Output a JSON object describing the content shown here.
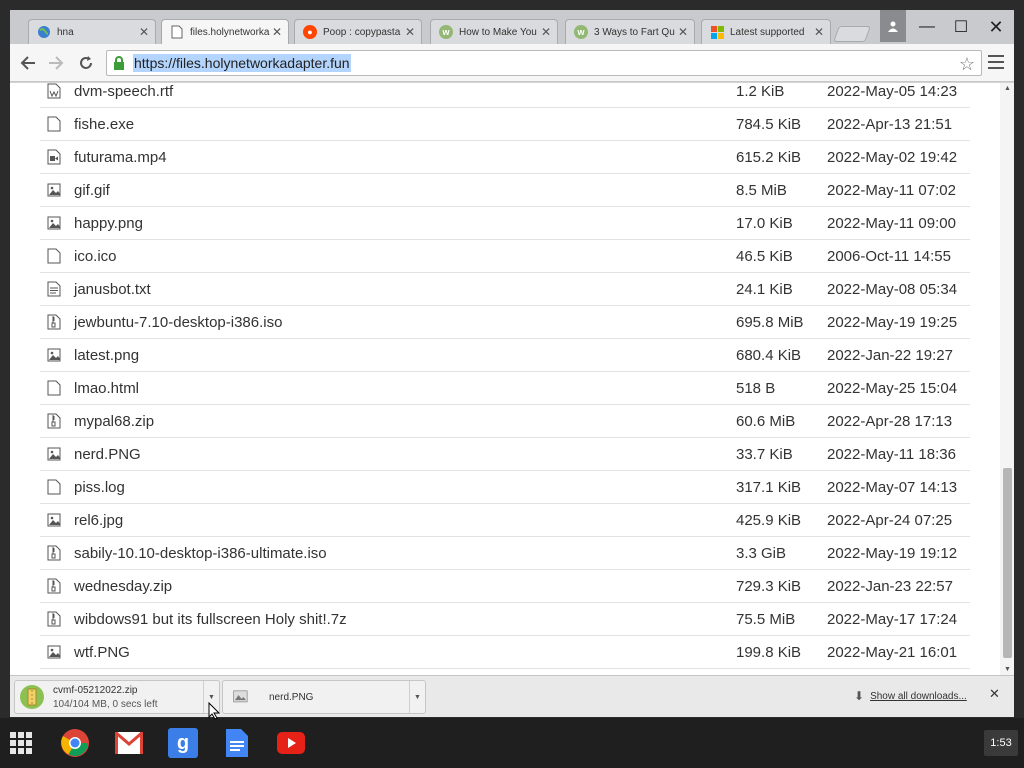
{
  "browser": {
    "tabs": [
      {
        "title": "hna",
        "icon": "globe-icon",
        "active": false
      },
      {
        "title": "files.holynetworka",
        "icon": "page-icon",
        "active": true
      },
      {
        "title": "Poop : copypasta",
        "icon": "reddit-icon",
        "active": false
      },
      {
        "title": "How to Make You",
        "icon": "wikihow-icon",
        "active": false
      },
      {
        "title": "3 Ways to Fart Qu",
        "icon": "wikihow-icon",
        "active": false
      },
      {
        "title": "Latest supported",
        "icon": "microsoft-icon",
        "active": false
      }
    ],
    "url": "https://files.holynetworkadapter.fun"
  },
  "files": [
    {
      "name": "dvm-speech.rtf",
      "size": "1.2 KiB",
      "date": "2022-May-05 14:23",
      "icon": "doc-icon"
    },
    {
      "name": "fishe.exe",
      "size": "784.5 KiB",
      "date": "2022-Apr-13 21:51",
      "icon": "file-icon"
    },
    {
      "name": "futurama.mp4",
      "size": "615.2 KiB",
      "date": "2022-May-02 19:42",
      "icon": "video-icon"
    },
    {
      "name": "gif.gif",
      "size": "8.5 MiB",
      "date": "2022-May-11 07:02",
      "icon": "image-icon"
    },
    {
      "name": "happy.png",
      "size": "17.0 KiB",
      "date": "2022-May-11 09:00",
      "icon": "image-icon"
    },
    {
      "name": "ico.ico",
      "size": "46.5 KiB",
      "date": "2006-Oct-11 14:55",
      "icon": "file-icon"
    },
    {
      "name": "janusbot.txt",
      "size": "24.1 KiB",
      "date": "2022-May-08 05:34",
      "icon": "text-icon"
    },
    {
      "name": "jewbuntu-7.10-desktop-i386.iso",
      "size": "695.8 MiB",
      "date": "2022-May-19 19:25",
      "icon": "archive-icon"
    },
    {
      "name": "latest.png",
      "size": "680.4 KiB",
      "date": "2022-Jan-22 19:27",
      "icon": "image-icon"
    },
    {
      "name": "lmao.html",
      "size": "518 B",
      "date": "2022-May-25 15:04",
      "icon": "file-icon"
    },
    {
      "name": "mypal68.zip",
      "size": "60.6 MiB",
      "date": "2022-Apr-28 17:13",
      "icon": "archive-icon"
    },
    {
      "name": "nerd.PNG",
      "size": "33.7 KiB",
      "date": "2022-May-11 18:36",
      "icon": "image-icon"
    },
    {
      "name": "piss.log",
      "size": "317.1 KiB",
      "date": "2022-May-07 14:13",
      "icon": "file-icon"
    },
    {
      "name": "rel6.jpg",
      "size": "425.9 KiB",
      "date": "2022-Apr-24 07:25",
      "icon": "image-icon"
    },
    {
      "name": "sabily-10.10-desktop-i386-ultimate.iso",
      "size": "3.3 GiB",
      "date": "2022-May-19 19:12",
      "icon": "archive-icon"
    },
    {
      "name": "wednesday.zip",
      "size": "729.3 KiB",
      "date": "2022-Jan-23 22:57",
      "icon": "archive-icon"
    },
    {
      "name": "wibdows91 but its fullscreen Holy shit!.7z",
      "size": "75.5 MiB",
      "date": "2022-May-17 17:24",
      "icon": "archive-icon"
    },
    {
      "name": "wtf.PNG",
      "size": "199.8 KiB",
      "date": "2022-May-21 16:01",
      "icon": "image-icon"
    }
  ],
  "downloads": {
    "items": [
      {
        "name": "cvmf-05212022.zip",
        "status": "104/104 MB, 0 secs left"
      },
      {
        "name": "nerd.PNG",
        "status": ""
      }
    ],
    "show_all": "Show all downloads..."
  },
  "taskbar": {
    "apps": [
      "chrome-icon",
      "gmail-icon",
      "google-search-icon",
      "docs-icon",
      "youtube-icon"
    ],
    "clock": "1:53"
  }
}
